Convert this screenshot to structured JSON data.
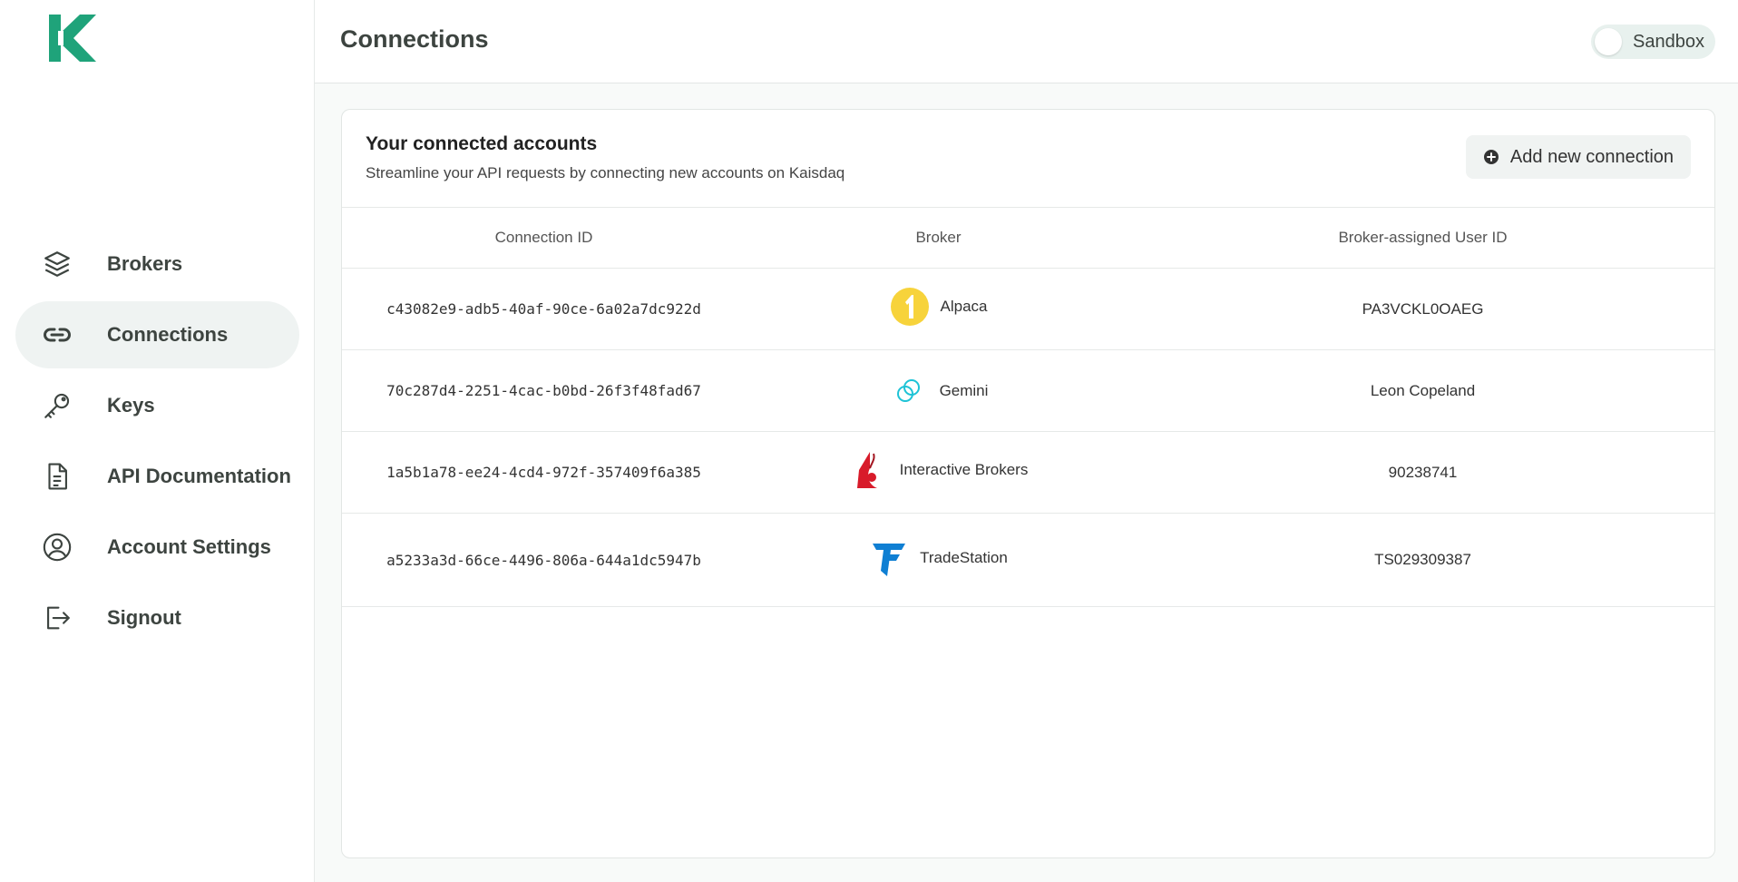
{
  "app": {
    "brand_color": "#1fa37a"
  },
  "sidebar": {
    "items": [
      {
        "label": "Brokers",
        "icon": "layers-icon",
        "active": false
      },
      {
        "label": "Connections",
        "icon": "link-icon",
        "active": true
      },
      {
        "label": "Keys",
        "icon": "key-icon",
        "active": false
      },
      {
        "label": "API Documentation",
        "icon": "document-icon",
        "active": false
      },
      {
        "label": "Account Settings",
        "icon": "user-circle-icon",
        "active": false
      },
      {
        "label": "Signout",
        "icon": "signout-icon",
        "active": false
      }
    ]
  },
  "header": {
    "title": "Connections",
    "sandbox_label": "Sandbox",
    "sandbox_enabled": false
  },
  "card": {
    "title": "Your connected accounts",
    "subtitle": "Streamline your API requests by connecting new accounts on Kaisdaq",
    "add_button_label": "Add new connection"
  },
  "table": {
    "columns": [
      "Connection ID",
      "Broker",
      "Broker-assigned User ID"
    ],
    "rows": [
      {
        "connection_id": "c43082e9-adb5-40af-90ce-6a02a7dc922d",
        "broker": "Alpaca",
        "broker_icon": "alpaca-logo",
        "user_id": "PA3VCKL0OAEG"
      },
      {
        "connection_id": "70c287d4-2251-4cac-b0bd-26f3f48fad67",
        "broker": "Gemini",
        "broker_icon": "gemini-logo",
        "user_id": "Leon Copeland"
      },
      {
        "connection_id": "1a5b1a78-ee24-4cd4-972f-357409f6a385",
        "broker": "Interactive Brokers",
        "broker_icon": "interactive-brokers-logo",
        "user_id": "90238741"
      },
      {
        "connection_id": "a5233a3d-66ce-4496-806a-644a1dc5947b",
        "broker": "TradeStation",
        "broker_icon": "tradestation-logo",
        "user_id": "TS029309387"
      }
    ]
  }
}
